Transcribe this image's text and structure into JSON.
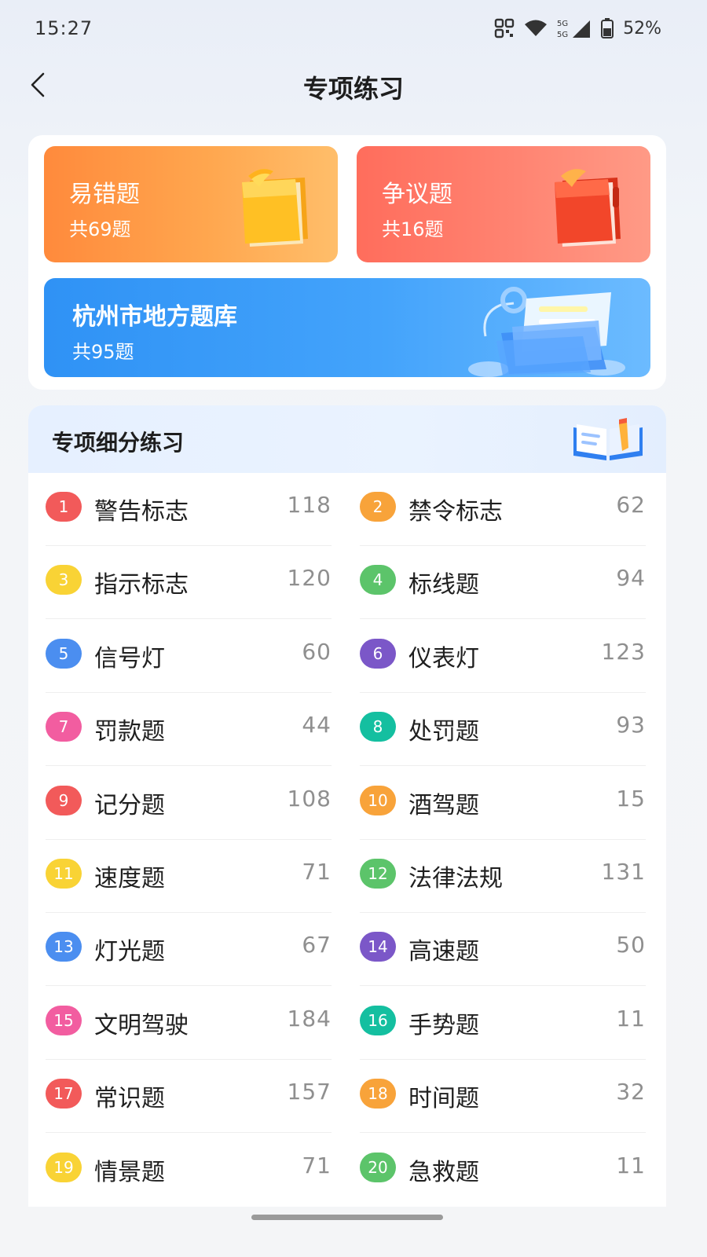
{
  "status_bar": {
    "time": "15:27",
    "battery": "52%",
    "network": "5G"
  },
  "header": {
    "title": "专项练习"
  },
  "tiles": {
    "error_prone": {
      "title": "易错题",
      "count": "共69题"
    },
    "disputed": {
      "title": "争议题",
      "count": "共16题"
    },
    "local_bank": {
      "title": "杭州市地方题库",
      "count": "共95题"
    }
  },
  "panel": {
    "title": "专项细分练习",
    "items": [
      {
        "num": "1",
        "label": "警告标志",
        "count": "118",
        "color": "#f25a5a"
      },
      {
        "num": "2",
        "label": "禁令标志",
        "count": "62",
        "color": "#f8a33a"
      },
      {
        "num": "3",
        "label": "指示标志",
        "count": "120",
        "color": "#f9d335"
      },
      {
        "num": "4",
        "label": "标线题",
        "count": "94",
        "color": "#5cc46a"
      },
      {
        "num": "5",
        "label": "信号灯",
        "count": "60",
        "color": "#4b8ef0"
      },
      {
        "num": "6",
        "label": "仪表灯",
        "count": "123",
        "color": "#7b57c8"
      },
      {
        "num": "7",
        "label": "罚款题",
        "count": "44",
        "color": "#f25da0"
      },
      {
        "num": "8",
        "label": "处罚题",
        "count": "93",
        "color": "#14bfa0"
      },
      {
        "num": "9",
        "label": "记分题",
        "count": "108",
        "color": "#f25a5a"
      },
      {
        "num": "10",
        "label": "酒驾题",
        "count": "15",
        "color": "#f8a33a"
      },
      {
        "num": "11",
        "label": "速度题",
        "count": "71",
        "color": "#f9d335"
      },
      {
        "num": "12",
        "label": "法律法规",
        "count": "131",
        "color": "#5cc46a"
      },
      {
        "num": "13",
        "label": "灯光题",
        "count": "67",
        "color": "#4b8ef0"
      },
      {
        "num": "14",
        "label": "高速题",
        "count": "50",
        "color": "#7b57c8"
      },
      {
        "num": "15",
        "label": "文明驾驶",
        "count": "184",
        "color": "#f25da0"
      },
      {
        "num": "16",
        "label": "手势题",
        "count": "11",
        "color": "#14bfa0"
      },
      {
        "num": "17",
        "label": "常识题",
        "count": "157",
        "color": "#f25a5a"
      },
      {
        "num": "18",
        "label": "时间题",
        "count": "32",
        "color": "#f8a33a"
      },
      {
        "num": "19",
        "label": "情景题",
        "count": "71",
        "color": "#f9d335"
      },
      {
        "num": "20",
        "label": "急救题",
        "count": "11",
        "color": "#5cc46a"
      }
    ]
  }
}
